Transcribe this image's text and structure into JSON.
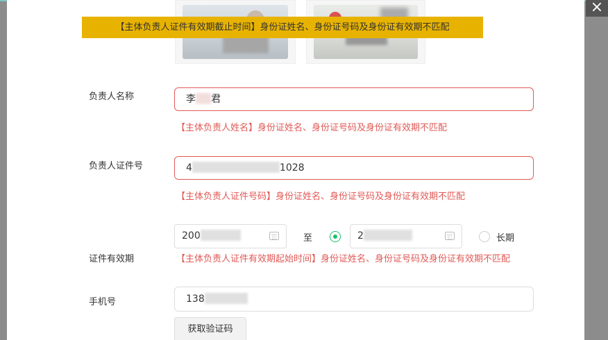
{
  "close_icon": "×",
  "banner_error": "【主体负责人证件有效期截止时间】身份证姓名、身份证号码及身份证有效期不匹配",
  "name": {
    "label": "负责人名称",
    "value_prefix": "李",
    "value_suffix": "君",
    "error": "【主体负责人姓名】身份证姓名、身份证号码及身份证有效期不匹配"
  },
  "id_number": {
    "label": "负责人证件号",
    "value_prefix": "4",
    "value_suffix": "1028",
    "error": "【主体负责人证件号码】身份证姓名、身份证号码及身份证有效期不匹配"
  },
  "validity": {
    "label": "证件有效期",
    "start_value": "200",
    "separator": "至",
    "end_value": "2",
    "long_term_label": "长期",
    "end_date_selected": true,
    "error": "【主体负责人证件有效期起始时间】身份证姓名、身份证号码及身份证有效期不匹配"
  },
  "phone": {
    "label": "手机号",
    "value_prefix": "138"
  },
  "get_code_button": "获取验证码",
  "colors": {
    "error": "#e05a56",
    "banner": "#e8b300",
    "radio_active": "#1bbf6c"
  }
}
